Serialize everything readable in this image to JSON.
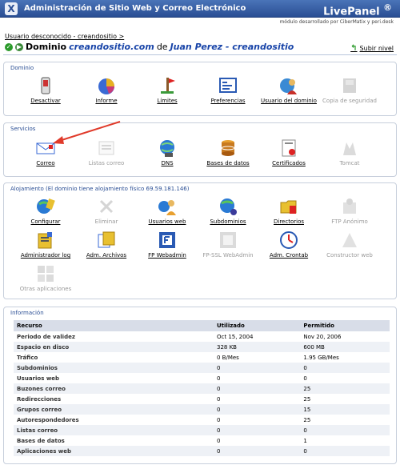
{
  "header": {
    "title": "Administración de Sitio Web y Correo Electrónico",
    "brand": "LivePanel",
    "brand_mark": "®",
    "credit": "módulo desarrollado por CiberMatix y peri.desk",
    "logo": "X"
  },
  "breadcrumb": "Usuario desconocido - creandositio >",
  "domain": {
    "prefix": "Dominio",
    "name": "creandositio.com",
    "de": "de",
    "owner": "Juan Perez - creandositio"
  },
  "subir": "Subir nivel",
  "panels": {
    "dominio": {
      "title": "Dominio",
      "items": [
        {
          "label": "Desactivar",
          "icon": "power-switch-icon",
          "enabled": true
        },
        {
          "label": "Informe",
          "icon": "pie-chart-icon",
          "enabled": true
        },
        {
          "label": "Límites",
          "icon": "limits-icon",
          "enabled": true
        },
        {
          "label": "Preferencias",
          "icon": "preferences-icon",
          "enabled": true
        },
        {
          "label": "Usuario del dominio",
          "icon": "domain-user-icon",
          "enabled": true
        },
        {
          "label": "Copia de seguridad",
          "icon": "backup-icon",
          "enabled": false
        }
      ]
    },
    "servicios": {
      "title": "Servicios",
      "items": [
        {
          "label": "Correo",
          "icon": "mail-icon",
          "enabled": true
        },
        {
          "label": "Listas correo",
          "icon": "mailing-lists-icon",
          "enabled": false
        },
        {
          "label": "DNS",
          "icon": "dns-icon",
          "enabled": true
        },
        {
          "label": "Bases de datos",
          "icon": "database-icon",
          "enabled": true
        },
        {
          "label": "Certificados",
          "icon": "certificate-icon",
          "enabled": true
        },
        {
          "label": "Tomcat",
          "icon": "tomcat-icon",
          "enabled": false
        }
      ]
    },
    "alojamiento": {
      "title": "Alojamiento (El dominio tiene alojamiento físico 69.59.181.146)",
      "items": [
        {
          "label": "Configurar",
          "icon": "configure-icon",
          "enabled": true
        },
        {
          "label": "Eliminar",
          "icon": "delete-icon",
          "enabled": false
        },
        {
          "label": "Usuarios web",
          "icon": "web-users-icon",
          "enabled": true
        },
        {
          "label": "Subdominios",
          "icon": "subdomains-icon",
          "enabled": true
        },
        {
          "label": "Directorios",
          "icon": "directories-icon",
          "enabled": true
        },
        {
          "label": "FTP Anónimo",
          "icon": "anonymous-ftp-icon",
          "enabled": false
        },
        {
          "label": "Administrador log",
          "icon": "log-manager-icon",
          "enabled": true
        },
        {
          "label": "Adm. Archivos",
          "icon": "file-manager-icon",
          "enabled": true
        },
        {
          "label": "FP Webadmin",
          "icon": "frontpage-icon",
          "enabled": true
        },
        {
          "label": "FP-SSL WebAdmin",
          "icon": "frontpage-ssl-icon",
          "enabled": false
        },
        {
          "label": "Adm. Crontab",
          "icon": "crontab-icon",
          "enabled": true
        },
        {
          "label": "Constructor web",
          "icon": "site-builder-icon",
          "enabled": false
        },
        {
          "label": "Otras aplicaciones",
          "icon": "other-apps-icon",
          "enabled": false
        }
      ]
    },
    "informacion": {
      "title": "Información",
      "columns": [
        "Recurso",
        "Utilizado",
        "Permitido"
      ],
      "rows": [
        [
          "Periodo de validez",
          "Oct 15, 2004",
          "Nov 20, 2006"
        ],
        [
          "Espacio en disco",
          "328 KB",
          "600 MB"
        ],
        [
          "Tráfico",
          "0 B/Mes",
          "1.95 GB/Mes"
        ],
        [
          "Subdominios",
          "0",
          "0"
        ],
        [
          "Usuarios web",
          "0",
          "0"
        ],
        [
          "Buzones correo",
          "0",
          "25"
        ],
        [
          "Redirecciones",
          "0",
          "25"
        ],
        [
          "Grupos correo",
          "0",
          "15"
        ],
        [
          "Autorespondedores",
          "0",
          "25"
        ],
        [
          "Listas correo",
          "0",
          "0"
        ],
        [
          "Bases de datos",
          "0",
          "1"
        ],
        [
          "Aplicaciones web",
          "0",
          "0"
        ]
      ]
    }
  },
  "colors": {
    "header_bg": "#2a4e94",
    "panel_title": "#2a4e94",
    "link_blue": "#1844a8",
    "arrow": "#e03a2a"
  }
}
